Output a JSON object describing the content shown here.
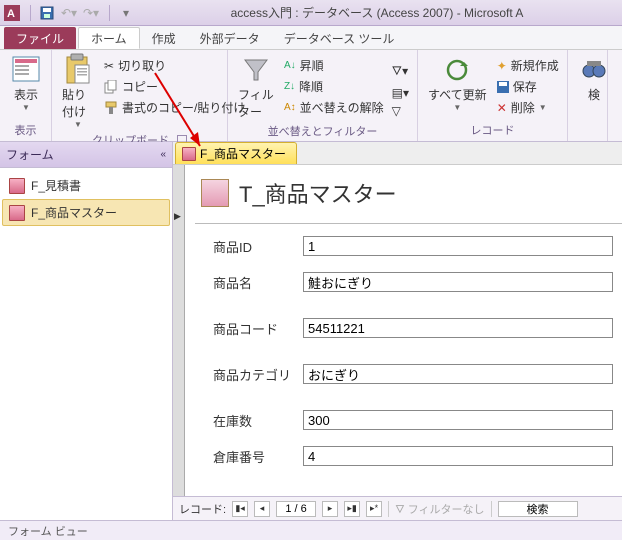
{
  "title": "access入門 : データベース (Access 2007) - Microsoft A",
  "tabs": {
    "file": "ファイル",
    "home": "ホーム",
    "create": "作成",
    "external": "外部データ",
    "dbtools": "データベース ツール"
  },
  "ribbon": {
    "view": {
      "label": "表示",
      "group": "表示"
    },
    "clipboard": {
      "paste": "貼り付け",
      "cut": "切り取り",
      "copy": "コピー",
      "fmtpainter": "書式のコピー/貼り付け",
      "group": "クリップボード"
    },
    "sort": {
      "filter": "フィルター",
      "asc": "昇順",
      "desc": "降順",
      "clear": "並べ替えの解除",
      "group": "並べ替えとフィルター"
    },
    "refresh": {
      "label": "すべて更新"
    },
    "records": {
      "new": "新規作成",
      "save": "保存",
      "delete": "削除",
      "group": "レコード"
    },
    "find": {
      "label": "検"
    }
  },
  "nav": {
    "header": "フォーム",
    "items": [
      {
        "label": "F_見積書"
      },
      {
        "label": "F_商品マスター"
      }
    ]
  },
  "form": {
    "tab": "F_商品マスター",
    "title": "T_商品マスター",
    "fields": {
      "id": {
        "label": "商品ID",
        "value": "1"
      },
      "name": {
        "label": "商品名",
        "value": "鮭おにぎり"
      },
      "code": {
        "label": "商品コード",
        "value": "54511221"
      },
      "cat": {
        "label": "商品カテゴリ",
        "value": "おにぎり"
      },
      "stock": {
        "label": "在庫数",
        "value": "300"
      },
      "wh": {
        "label": "倉庫番号",
        "value": "4"
      }
    }
  },
  "recnav": {
    "label": "レコード:",
    "pos": "1 / 6",
    "nofilter": "フィルターなし",
    "search": "検索"
  },
  "status": "フォーム ビュー"
}
